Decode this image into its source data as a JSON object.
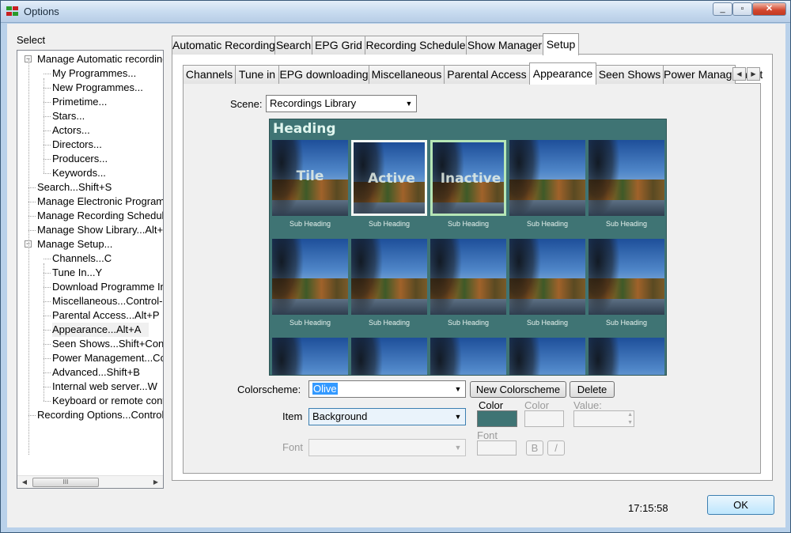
{
  "window": {
    "title": "Options"
  },
  "colors": {
    "preview_bg": "#3f7474",
    "accent": "#3399ff"
  },
  "select_label": "Select",
  "tree": {
    "nodes": [
      {
        "text": "Manage Automatic recording...",
        "level": 0,
        "expander": "−"
      },
      {
        "text": "My Programmes...",
        "level": 1
      },
      {
        "text": "New Programmes...",
        "level": 1
      },
      {
        "text": "Primetime...",
        "level": 1
      },
      {
        "text": "Stars...",
        "level": 1
      },
      {
        "text": "Actors...",
        "level": 1
      },
      {
        "text": "Directors...",
        "level": 1
      },
      {
        "text": "Producers...",
        "level": 1
      },
      {
        "text": "Keywords...",
        "level": 1
      },
      {
        "text": "Search...Shift+S",
        "level": 0
      },
      {
        "text": "Manage Electronic Programme Guide",
        "level": 0
      },
      {
        "text": "Manage Recording Schedule",
        "level": 0
      },
      {
        "text": "Manage Show Library...Alt+L",
        "level": 0
      },
      {
        "text": "Manage Setup...",
        "level": 0,
        "expander": "−"
      },
      {
        "text": "Channels...C",
        "level": 1
      },
      {
        "text": "Tune In...Y",
        "level": 1
      },
      {
        "text": "Download Programme Info",
        "level": 1
      },
      {
        "text": "Miscellaneous...Control-M",
        "level": 1
      },
      {
        "text": "Parental Access...Alt+P",
        "level": 1
      },
      {
        "text": "Appearance...Alt+A",
        "level": 1,
        "selected": true
      },
      {
        "text": "Seen Shows...Shift+Control",
        "level": 1
      },
      {
        "text": "Power Management...Control",
        "level": 1
      },
      {
        "text": "Advanced...Shift+B",
        "level": 1
      },
      {
        "text": "Internal web server...W",
        "level": 1
      },
      {
        "text": "Keyboard or remote control",
        "level": 1
      },
      {
        "text": "Recording Options...Control+R",
        "level": 0
      }
    ],
    "scroll_thumb_glyph": "III"
  },
  "outer_tabs": [
    {
      "label": "Automatic Recording"
    },
    {
      "label": "Search"
    },
    {
      "label": "EPG Grid"
    },
    {
      "label": "Recording Schedule"
    },
    {
      "label": "Show Manager"
    },
    {
      "label": "Setup",
      "active": true
    }
  ],
  "inner_tabs": [
    {
      "label": "Channels"
    },
    {
      "label": "Tune in"
    },
    {
      "label": "EPG downloading"
    },
    {
      "label": "Miscellaneous"
    },
    {
      "label": "Parental Access"
    },
    {
      "label": "Appearance",
      "active": true
    },
    {
      "label": "Seen Shows"
    },
    {
      "label": "Power Management"
    }
  ],
  "appearance": {
    "scene_label": "Scene:",
    "scene_value": "Recordings Library",
    "preview": {
      "heading": "Heading",
      "row1_labels": [
        "Tile",
        "Active",
        "Inactive",
        "",
        ""
      ],
      "subheading": "Sub Heading"
    },
    "colorscheme_label": "Colorscheme:",
    "colorscheme_value": "Olive",
    "new_colorscheme_btn": "New Colorscheme",
    "delete_btn": "Delete",
    "item_label": "Item",
    "item_value": "Background",
    "color_label": "Color",
    "color_value": "#3f7474",
    "color2_label": "Color",
    "value_label": "Value:",
    "font_label": "Font",
    "font_small_label": "Font",
    "bold_btn": "B",
    "italic_btn": "/"
  },
  "clock": "17:15:58",
  "ok_button": "OK"
}
